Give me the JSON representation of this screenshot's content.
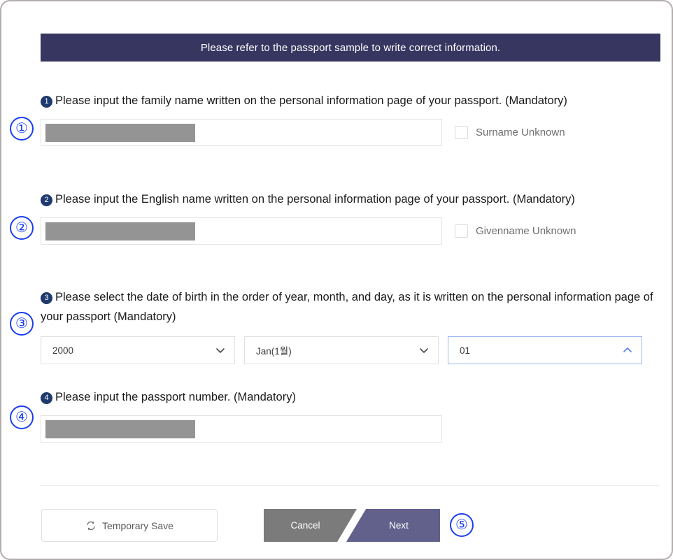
{
  "banner": {
    "text": "Please refer to the passport sample to write correct information."
  },
  "annotations": [
    {
      "label": "①"
    },
    {
      "label": "②"
    },
    {
      "label": "③"
    },
    {
      "label": "④"
    },
    {
      "label": "⑤"
    }
  ],
  "questions": [
    {
      "number": "1",
      "text": "Please input the family name written on the personal information page of your passport. (Mandatory)",
      "input": {
        "value": "",
        "redacted": true
      },
      "checkbox": {
        "label": "Surname Unknown",
        "checked": false
      }
    },
    {
      "number": "2",
      "text": "Please input the English name written on the personal information page of your passport. (Mandatory)",
      "input": {
        "value": "",
        "redacted": true
      },
      "checkbox": {
        "label": "Givenname Unknown",
        "checked": false
      }
    },
    {
      "number": "3",
      "text": "Please select the date of birth in the order of year, month, and day, as it is written on the personal information page of your passport (Mandatory)",
      "selects": [
        {
          "name": "year",
          "value": "2000",
          "state": "closed",
          "icon": "chevron-down-icon"
        },
        {
          "name": "month",
          "value": "Jan(1월)",
          "state": "closed",
          "icon": "chevron-down-icon"
        },
        {
          "name": "day",
          "value": "01",
          "state": "open",
          "icon": "chevron-up-icon"
        }
      ]
    },
    {
      "number": "4",
      "text": "Please input the passport number. (Mandatory)",
      "input": {
        "value": "",
        "redacted": true
      }
    }
  ],
  "footer": {
    "temporary_save_label": "Temporary Save",
    "temporary_save_icon": "sync-icon",
    "cancel_label": "Cancel",
    "next_label": "Next"
  },
  "colors": {
    "banner_bg": "#373661",
    "bullet_bg": "#1f3a6e",
    "annotation": "#1a3ef0",
    "cancel_bg": "#7b7b7b",
    "next_bg": "#61618c",
    "active_border": "#9cb6ef",
    "redaction": "#949494"
  }
}
